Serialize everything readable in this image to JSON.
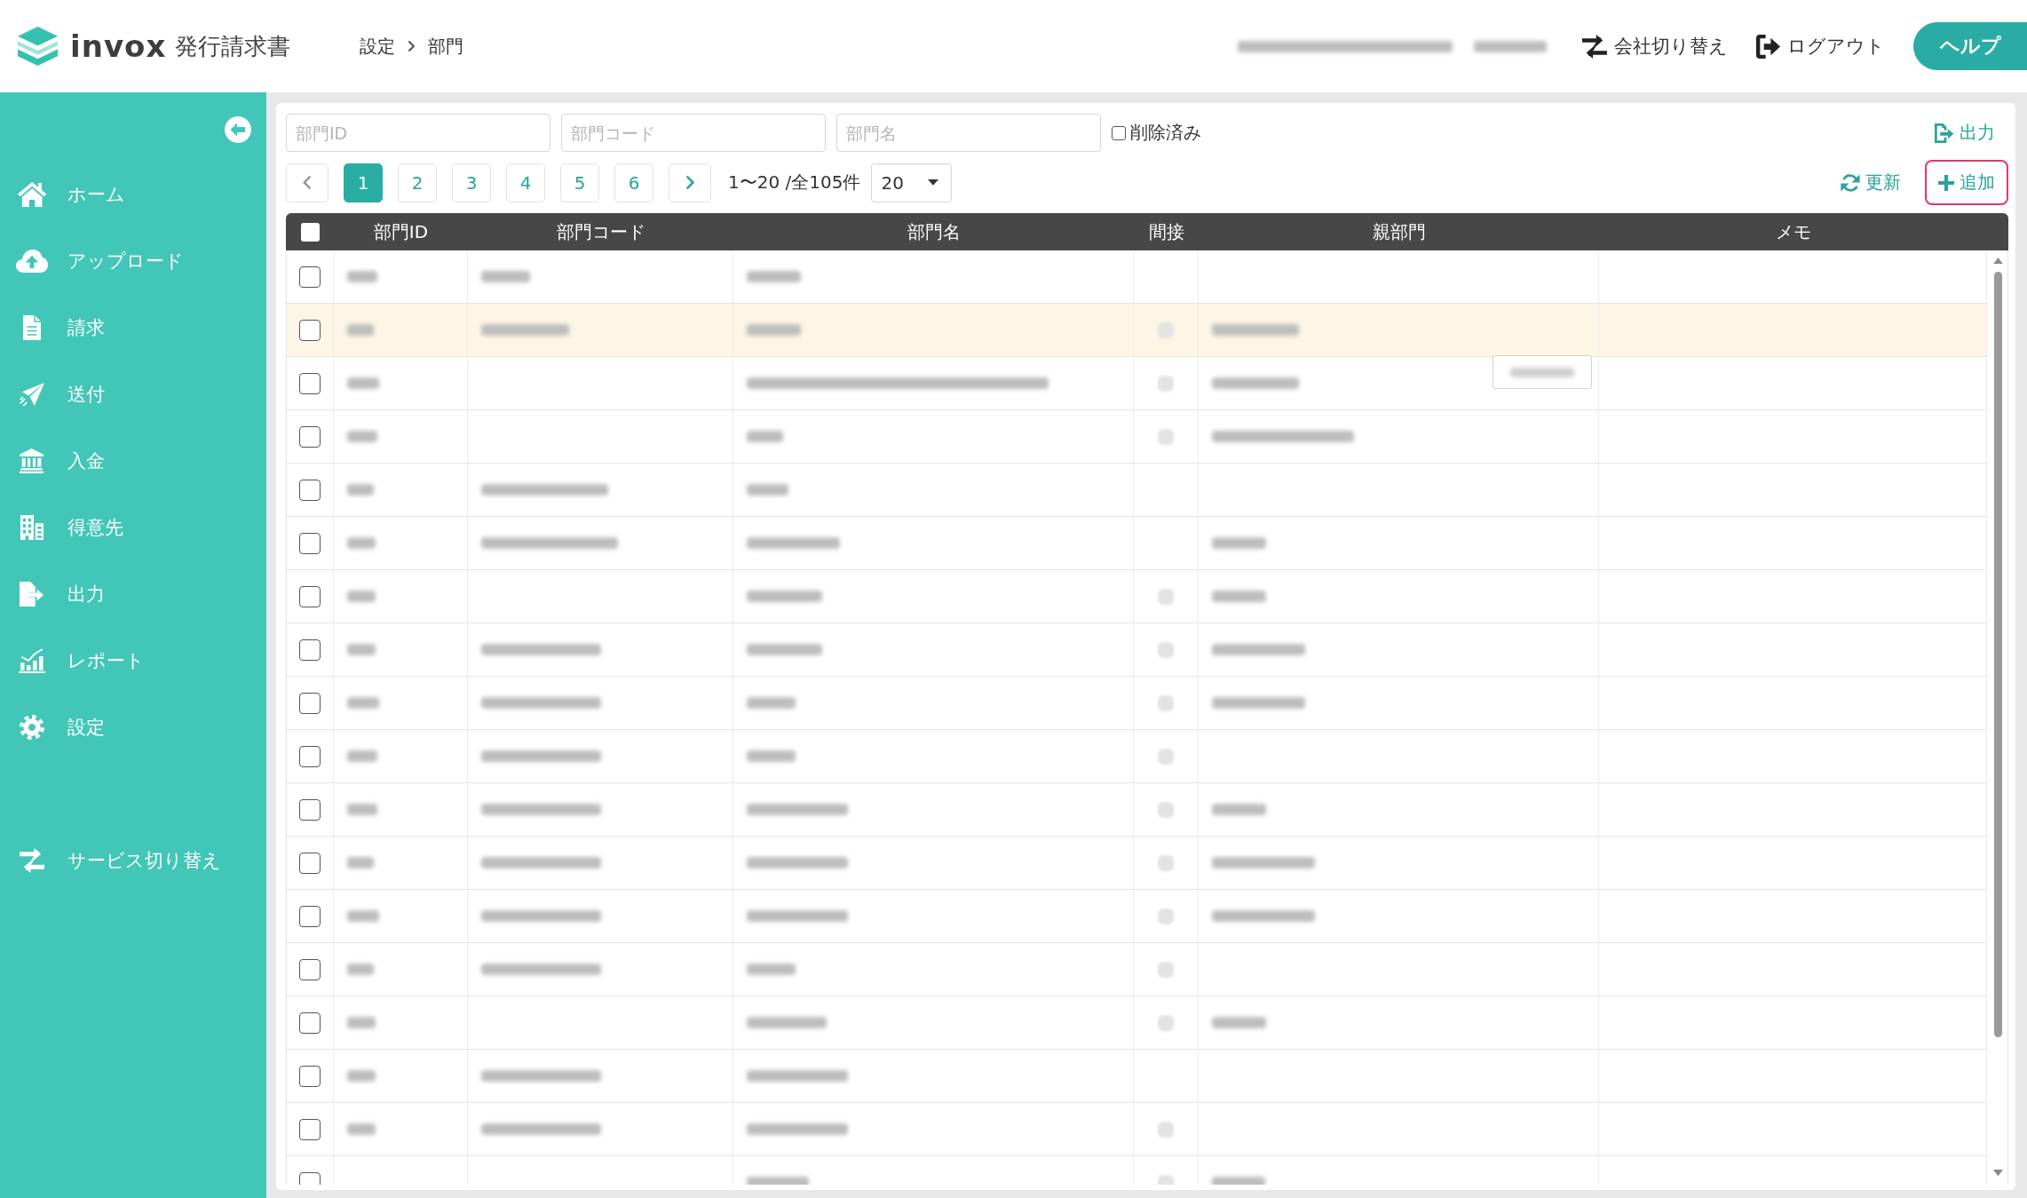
{
  "header": {
    "logo": "invox",
    "product": "発行請求書",
    "breadcrumb": [
      "設定",
      "部門"
    ],
    "account_blurred": true,
    "links": [
      "会社切り替え",
      "ログアウト"
    ],
    "help": "ヘルプ"
  },
  "sidebar": {
    "items": [
      "ホーム",
      "アップロード",
      "請求",
      "送付",
      "入金",
      "得意先",
      "出力",
      "レポート",
      "設定"
    ],
    "bottom_items": [
      "サービス切り替え"
    ]
  },
  "filters": {
    "fields": [
      {
        "placeholder": "部門ID"
      },
      {
        "placeholder": "部門コード"
      },
      {
        "placeholder": "部門名"
      }
    ],
    "deleted": {
      "label": "削除済み",
      "checked": false
    },
    "export": "出力"
  },
  "pagination": {
    "prev": {
      "disabled": true
    },
    "pages": [
      {
        "label": "1",
        "selected": true
      },
      {
        "label": "2",
        "selected": false
      },
      {
        "label": "3",
        "selected": false
      },
      {
        "label": "4",
        "selected": false
      },
      {
        "label": "5",
        "selected": false
      },
      {
        "label": "6",
        "selected": false
      }
    ],
    "next": {
      "disabled": false
    },
    "summary": "1〜20 /全105件",
    "page_size": "20"
  },
  "toolbar": {
    "refresh": "更新",
    "add": {
      "label": "追加",
      "highlighted": true
    }
  },
  "table": {
    "all_checked": false,
    "columns": [
      "部門ID",
      "部門コード",
      "部門名",
      "間接",
      "親部門",
      "メモ"
    ],
    "tooltip_blurred": true,
    "rows": [
      {
        "checked": false,
        "hovered": false,
        "cells": {
          "id": true,
          "code": true,
          "name": true,
          "indirect": false,
          "parent": false
        }
      },
      {
        "checked": false,
        "hovered": true,
        "cells": {
          "id": true,
          "code": true,
          "name": true,
          "indirect": true,
          "parent": true
        }
      },
      {
        "checked": false,
        "hovered": false,
        "cells": {
          "id": true,
          "code": false,
          "name": true,
          "indirect": true,
          "parent": true
        }
      },
      {
        "checked": false,
        "hovered": false,
        "cells": {
          "id": true,
          "code": false,
          "name": true,
          "indirect": true,
          "parent": true
        }
      },
      {
        "checked": false,
        "hovered": false,
        "cells": {
          "id": true,
          "code": true,
          "name": true,
          "indirect": false,
          "parent": false
        }
      },
      {
        "checked": false,
        "hovered": false,
        "cells": {
          "id": true,
          "code": true,
          "name": true,
          "indirect": false,
          "parent": true
        }
      },
      {
        "checked": false,
        "hovered": false,
        "cells": {
          "id": true,
          "code": false,
          "name": true,
          "indirect": true,
          "parent": true
        }
      },
      {
        "checked": false,
        "hovered": false,
        "cells": {
          "id": true,
          "code": true,
          "name": true,
          "indirect": true,
          "parent": true
        }
      },
      {
        "checked": false,
        "hovered": false,
        "cells": {
          "id": true,
          "code": true,
          "name": true,
          "indirect": true,
          "parent": true
        }
      },
      {
        "checked": false,
        "hovered": false,
        "cells": {
          "id": true,
          "code": true,
          "name": true,
          "indirect": true,
          "parent": false
        }
      },
      {
        "checked": false,
        "hovered": false,
        "cells": {
          "id": true,
          "code": true,
          "name": true,
          "indirect": true,
          "parent": true
        }
      },
      {
        "checked": false,
        "hovered": false,
        "cells": {
          "id": true,
          "code": true,
          "name": true,
          "indirect": true,
          "parent": true
        }
      },
      {
        "checked": false,
        "hovered": false,
        "cells": {
          "id": true,
          "code": true,
          "name": true,
          "indirect": true,
          "parent": true
        }
      },
      {
        "checked": false,
        "hovered": false,
        "cells": {
          "id": true,
          "code": true,
          "name": true,
          "indirect": true,
          "parent": false
        }
      },
      {
        "checked": false,
        "hovered": false,
        "cells": {
          "id": true,
          "code": false,
          "name": true,
          "indirect": true,
          "parent": true
        }
      },
      {
        "checked": false,
        "hovered": false,
        "cells": {
          "id": true,
          "code": true,
          "name": true,
          "indirect": false,
          "parent": false
        }
      },
      {
        "checked": false,
        "hovered": false,
        "cells": {
          "id": true,
          "code": true,
          "name": true,
          "indirect": true,
          "parent": false
        }
      },
      {
        "checked": false,
        "hovered": false,
        "cells": {
          "id": false,
          "code": false,
          "name": true,
          "indirect": true,
          "parent": true
        }
      }
    ]
  }
}
